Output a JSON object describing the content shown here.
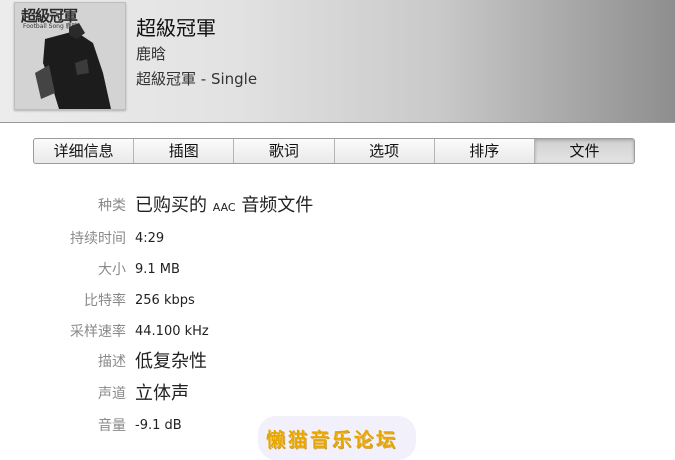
{
  "header": {
    "artwork_title": "超級冠軍",
    "artwork_subtitle": "Football Song 鹿晗",
    "title": "超級冠軍",
    "artist": "鹿晗",
    "album": "超級冠軍 - Single"
  },
  "tabs": [
    {
      "label": "详细信息",
      "active": false
    },
    {
      "label": "插图",
      "active": false
    },
    {
      "label": "歌词",
      "active": false
    },
    {
      "label": "选项",
      "active": false
    },
    {
      "label": "排序",
      "active": false
    },
    {
      "label": "文件",
      "active": true
    }
  ],
  "info": {
    "kind": {
      "label": "种类",
      "value_prefix": "已购买的",
      "value_codec": "AAC",
      "value_suffix": "音频文件"
    },
    "duration": {
      "label": "持续时间",
      "value": "4:29"
    },
    "size": {
      "label": "大小",
      "value": "9.1 MB"
    },
    "bitrate": {
      "label": "比特率",
      "value": "256 kbps"
    },
    "sample_rate": {
      "label": "采样速率",
      "value": "44.100 kHz"
    },
    "description": {
      "label": "描述",
      "value": "低复杂性"
    },
    "channels": {
      "label": "声道",
      "value": "立体声"
    },
    "volume": {
      "label": "音量",
      "value": "-9.1 dB"
    }
  },
  "watermark": "懒猫音乐论坛"
}
